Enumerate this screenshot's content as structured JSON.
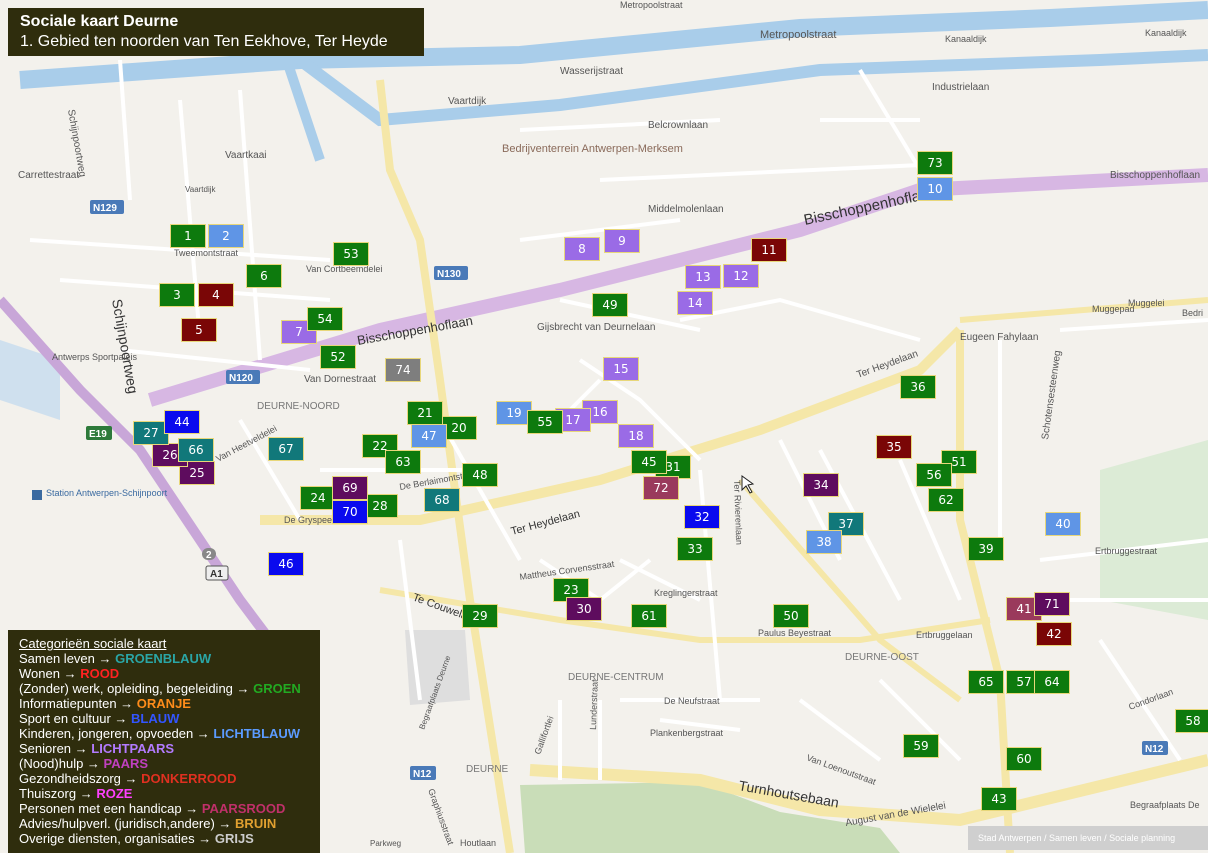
{
  "title": "Sociale kaart Deurne",
  "subtitle": "1. Gebied ten noorden van Ten Eekhove, Ter Heyde",
  "legend": {
    "heading": "Categorieën sociale kaart",
    "items": [
      {
        "label": "Samen leven →",
        "color_name": "GROENBLAUW",
        "color": "#2aa6a6"
      },
      {
        "label": "Wonen →",
        "color_name": "ROOD",
        "color": "#ff2222"
      },
      {
        "label": "(Zonder) werk, opleiding, begeleiding →",
        "color_name": "GROEN",
        "color": "#22aa22"
      },
      {
        "label": "Informatiepunten →",
        "color_name": "ORANJE",
        "color": "#ff8c1a"
      },
      {
        "label": "Sport en cultuur →",
        "color_name": "BLAUW",
        "color": "#3355ff"
      },
      {
        "label": "Kinderen, jongeren, opvoeden →",
        "color_name": "LICHTBLAUW",
        "color": "#5b9bff"
      },
      {
        "label": "Senioren →",
        "color_name": "LICHTPAARS",
        "color": "#b37bff"
      },
      {
        "label": "(Nood)hulp →",
        "color_name": "PAARS",
        "color": "#c040c0"
      },
      {
        "label": "Gezondheidszorg →",
        "color_name": "DONKERROOD",
        "color": "#e03020"
      },
      {
        "label": "Thuiszorg →",
        "color_name": "ROZE",
        "color": "#ff40ff"
      },
      {
        "label": "Personen met een handicap →",
        "color_name": "PAARSROOD",
        "color": "#c0306a"
      },
      {
        "label": "Advies/hulpverl. (juridisch,andere) →",
        "color_name": "BRUIN",
        "color": "#e0a030"
      },
      {
        "label": "Overige diensten, organisaties →",
        "color_name": "GRIJS",
        "color": "#cccccc"
      }
    ]
  },
  "marker_colors": {
    "groen": "#0d7a0d",
    "lichtblauw": "#5f95e6",
    "donkerrood": "#7a0606",
    "lichtpaars": "#9a6be6",
    "blauw": "#0a0aee",
    "groenblauw": "#11787a",
    "paars": "#5e0c5e",
    "paarsrood": "#9a3a5c",
    "grijs": "#7e7e7e"
  },
  "markers": [
    {
      "n": "1",
      "cat": "groen"
    },
    {
      "n": "2",
      "cat": "lichtblauw"
    },
    {
      "n": "3",
      "cat": "groen"
    },
    {
      "n": "4",
      "cat": "donkerrood"
    },
    {
      "n": "5",
      "cat": "donkerrood"
    },
    {
      "n": "6",
      "cat": "groen"
    },
    {
      "n": "7",
      "cat": "lichtpaars"
    },
    {
      "n": "8",
      "cat": "lichtpaars"
    },
    {
      "n": "9",
      "cat": "lichtpaars"
    },
    {
      "n": "10",
      "cat": "lichtblauw"
    },
    {
      "n": "11",
      "cat": "donkerrood"
    },
    {
      "n": "12",
      "cat": "lichtpaars"
    },
    {
      "n": "13",
      "cat": "lichtpaars"
    },
    {
      "n": "14",
      "cat": "lichtpaars"
    },
    {
      "n": "15",
      "cat": "lichtpaars"
    },
    {
      "n": "16",
      "cat": "lichtpaars"
    },
    {
      "n": "17",
      "cat": "lichtpaars"
    },
    {
      "n": "18",
      "cat": "lichtpaars"
    },
    {
      "n": "19",
      "cat": "lichtblauw"
    },
    {
      "n": "20",
      "cat": "groen"
    },
    {
      "n": "21",
      "cat": "groen"
    },
    {
      "n": "22",
      "cat": "groen"
    },
    {
      "n": "23",
      "cat": "groen"
    },
    {
      "n": "24",
      "cat": "groen"
    },
    {
      "n": "25",
      "cat": "paars"
    },
    {
      "n": "26",
      "cat": "paars"
    },
    {
      "n": "27",
      "cat": "groenblauw"
    },
    {
      "n": "28",
      "cat": "groen"
    },
    {
      "n": "29",
      "cat": "groen"
    },
    {
      "n": "30",
      "cat": "paars"
    },
    {
      "n": "31",
      "cat": "groen"
    },
    {
      "n": "32",
      "cat": "blauw"
    },
    {
      "n": "33",
      "cat": "groen"
    },
    {
      "n": "34",
      "cat": "paars"
    },
    {
      "n": "35",
      "cat": "donkerrood"
    },
    {
      "n": "36",
      "cat": "groen"
    },
    {
      "n": "37",
      "cat": "groenblauw"
    },
    {
      "n": "38",
      "cat": "lichtblauw"
    },
    {
      "n": "39",
      "cat": "groen"
    },
    {
      "n": "40",
      "cat": "lichtblauw"
    },
    {
      "n": "41",
      "cat": "paarsrood"
    },
    {
      "n": "42",
      "cat": "donkerrood"
    },
    {
      "n": "43",
      "cat": "groen"
    },
    {
      "n": "44",
      "cat": "blauw"
    },
    {
      "n": "45",
      "cat": "groen"
    },
    {
      "n": "46",
      "cat": "blauw"
    },
    {
      "n": "47",
      "cat": "lichtblauw"
    },
    {
      "n": "48",
      "cat": "groen"
    },
    {
      "n": "49",
      "cat": "groen"
    },
    {
      "n": "50",
      "cat": "groen"
    },
    {
      "n": "51",
      "cat": "groen"
    },
    {
      "n": "52",
      "cat": "groen"
    },
    {
      "n": "53",
      "cat": "groen"
    },
    {
      "n": "54",
      "cat": "groen"
    },
    {
      "n": "55",
      "cat": "groen"
    },
    {
      "n": "56",
      "cat": "groen"
    },
    {
      "n": "57",
      "cat": "groen"
    },
    {
      "n": "58",
      "cat": "groen"
    },
    {
      "n": "59",
      "cat": "groen"
    },
    {
      "n": "60",
      "cat": "groen"
    },
    {
      "n": "61",
      "cat": "groen"
    },
    {
      "n": "62",
      "cat": "groen"
    },
    {
      "n": "63",
      "cat": "groen"
    },
    {
      "n": "64",
      "cat": "groen"
    },
    {
      "n": "65",
      "cat": "groen"
    },
    {
      "n": "66",
      "cat": "groenblauw"
    },
    {
      "n": "67",
      "cat": "groenblauw"
    },
    {
      "n": "68",
      "cat": "groenblauw"
    },
    {
      "n": "69",
      "cat": "paars"
    },
    {
      "n": "70",
      "cat": "blauw"
    },
    {
      "n": "71",
      "cat": "paars"
    },
    {
      "n": "72",
      "cat": "paarsrood"
    },
    {
      "n": "73",
      "cat": "groen"
    },
    {
      "n": "74",
      "cat": "grijs"
    }
  ],
  "map_labels": {
    "metropoolstraat": "Metropoolstraat",
    "metropoolstraat_top": "Metropoolstraat",
    "kanaaldijk_a": "Kanaaldijk",
    "kanaaldijk_b": "Kanaaldijk",
    "wasserijstraat": "Wasserijstraat",
    "vaartdijk": "Vaartdijk",
    "industrielaan": "Industrielaan",
    "belcrownlaan": "Belcrownlaan",
    "bedrijventerrein": "Bedrijventerrein Antwerpen-Merksem",
    "vaartkaai": "Vaartkaai",
    "carrettestraat": "Carrettestraat",
    "vaartdijk_small": "Vaartdijk",
    "middelmolenlaan": "Middelmolenlaan",
    "bisschoppenhoflaan_a": "Bisschoppenhoflaan",
    "bisschoppenhoflaan_b": "Bisschoppenhoflaan",
    "bisschoppenhoflaan_c": "Bisschoppenhoflaan",
    "tweemontstraat": "Tweemontstraat",
    "van_cortbeemdelei": "Van Cortbeemdelei",
    "schijnpoortweg_a": "Schijnpoortweg",
    "schijnpoortweg_b": "Schijnpoortweg",
    "antwerps_sportpaleis": "Antwerps\nSportpaleis",
    "deurne_noord": "DEURNE-NOORD",
    "van_dornestraat": "Van Dornestraat",
    "gijsbrecht": "Gijsbrecht van Deurnelaan",
    "ter_heydelaan_a": "Ter Heydelaan",
    "ter_heydelaan_b": "Ter Heydelaan",
    "eugeen_fahylaan": "Eugeen Fahylaan",
    "muggepad": "Muggepad",
    "muggelei": "Muggelei",
    "schotensesteenweg": "Schotensesteenweg",
    "station": "Station\nAntwerpen-Schijnpoort",
    "van_heetveldelei": "Van Heetveldelei",
    "de_gryspeerstraat": "De Gryspeerstraat",
    "te_couwelaarlei": "Te Couwelaarlei",
    "matheus": "Mattheus Corvensstraat",
    "kreglingerstraat": "Kreglingerstraat",
    "paulus_beyestraat": "Paulus Beyestraat",
    "deurne_oost": "DEURNE-OOST",
    "ertbruggelaan": "Ertbruggelaan",
    "ertbruggestraat": "Ertbruggestraat",
    "deurne_centrum": "DEURNE-CENTRUM",
    "de_neufstraat": "De Neufstraat",
    "plankenbergstraat": "Plankenbergstraat",
    "turnhoutsebaan": "Turnhoutsebaan",
    "august_van_de_wiele": "August van de Wielelei",
    "van_loenoutstraat": "Van Loenoutstraat",
    "deurne_small": "DEURNE",
    "begraafplaats_deurne": "Begraafplaats Deurne",
    "begraafplaats_b": "Begraafplaats De",
    "condorlaan": "Condorlaan",
    "ter_rivierenlaan": "Ter Rivierenlaan",
    "de_berlaimontstraat": "De Berlaimontstraat",
    "a1": "A1",
    "e19": "E19",
    "n12a": "N12",
    "n12b": "N12",
    "n120": "N120",
    "n129": "N129",
    "n130": "N130",
    "two": "2",
    "parkweg": "Parkweg",
    "houtlaan": "Houtlaan",
    "bedri": "Bedri",
    "gallifortlei": "Gallifortlei",
    "lundenstraat": "Lunderstraat",
    "graphius": "Graphiusstraat"
  },
  "credit": "Stad Antwerpen / Samen leven / Sociale planning"
}
